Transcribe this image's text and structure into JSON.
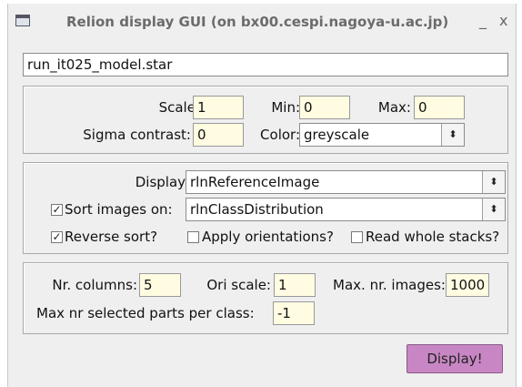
{
  "window": {
    "title": "Relion display GUI (on bx00.cespi.nagoya-u.ac.jp)",
    "minimize": "_",
    "close": "x"
  },
  "file_input": {
    "value": "run_it025_model.star"
  },
  "scale_group": {
    "scale_label": "Scale:",
    "scale_value": "1",
    "min_label": "Min:",
    "min_value": "0",
    "max_label": "Max:",
    "max_value": "0",
    "sigma_label": "Sigma contrast:",
    "sigma_value": "0",
    "color_label": "Color:",
    "color_value": "greyscale"
  },
  "display_group": {
    "display_label": "Display:",
    "display_value": "rlnReferenceImage",
    "sort_label": "Sort images on:",
    "sort_checked": true,
    "sort_value": "rlnClassDistribution",
    "reverse_label": "Reverse sort?",
    "reverse_checked": true,
    "apply_label": "Apply orientations?",
    "apply_checked": false,
    "read_label": "Read whole stacks?",
    "read_checked": false,
    "check_mark": "✓",
    "arrows": "⬍"
  },
  "columns_group": {
    "ncol_label": "Nr. columns:",
    "ncol_value": "5",
    "ori_label": "Ori scale:",
    "ori_value": "1",
    "maxnr_label": "Max. nr. images:",
    "maxnr_value": "1000",
    "maxsel_label": "Max nr selected parts per class:",
    "maxsel_value": "-1"
  },
  "display_button": {
    "label": "Display!",
    "color": "#c887c4"
  }
}
